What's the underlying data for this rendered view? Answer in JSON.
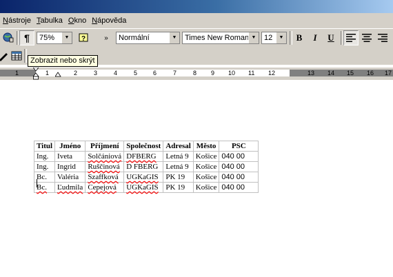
{
  "menu": {
    "items": [
      {
        "label": "Nástroje",
        "hot": "N",
        "rest": "ástroje"
      },
      {
        "label": "Tabulka",
        "hot": "T",
        "rest": "abulka"
      },
      {
        "label": "Okno",
        "hot": "O",
        "rest": "kno"
      },
      {
        "label": "Nápověda",
        "hot": "N",
        "rest": "ápověda"
      }
    ]
  },
  "toolbar": {
    "zoom": "75%",
    "style": "Normální",
    "font": "Times New Roman",
    "font_size": "12",
    "bold": "B",
    "italic": "I",
    "underline": "U",
    "tooltip": "Zobrazit nebo skrýt"
  },
  "ruler": {
    "numbers": [
      "1",
      "1",
      "2",
      "3",
      "4",
      "5",
      "6",
      "7",
      "8",
      "9",
      "10",
      "11",
      "12",
      "13",
      "14",
      "15",
      "16",
      "17",
      "18"
    ]
  },
  "table": {
    "headers": [
      "Titul",
      "Jméno",
      "Příjmení",
      "Společnost",
      "Adresal",
      "Město",
      "PSC"
    ],
    "rows": [
      [
        "Ing.",
        "Iveta",
        "Solčániová",
        "DFBERG",
        "Letná 9",
        "Košice",
        "040 00"
      ],
      [
        "Ing.",
        "Ingrid",
        "Ruščinová",
        "D FBERG",
        "Letná 9",
        "Košice",
        "040 00"
      ],
      [
        "Bc.",
        "Valéria",
        "Szaffková",
        "UGKaGIS",
        "PK 19",
        "Košice",
        "040 00"
      ],
      [
        "Bc.",
        "Ľudmila",
        "Cepejová",
        "UGKaGIS",
        "PK 19",
        "Košice",
        "040 00"
      ]
    ]
  },
  "colors": {
    "face": "#d4d0c8",
    "title_start": "#0a246a",
    "tooltip_bg": "#ffffe1",
    "spell_underline": "#ff0000"
  }
}
